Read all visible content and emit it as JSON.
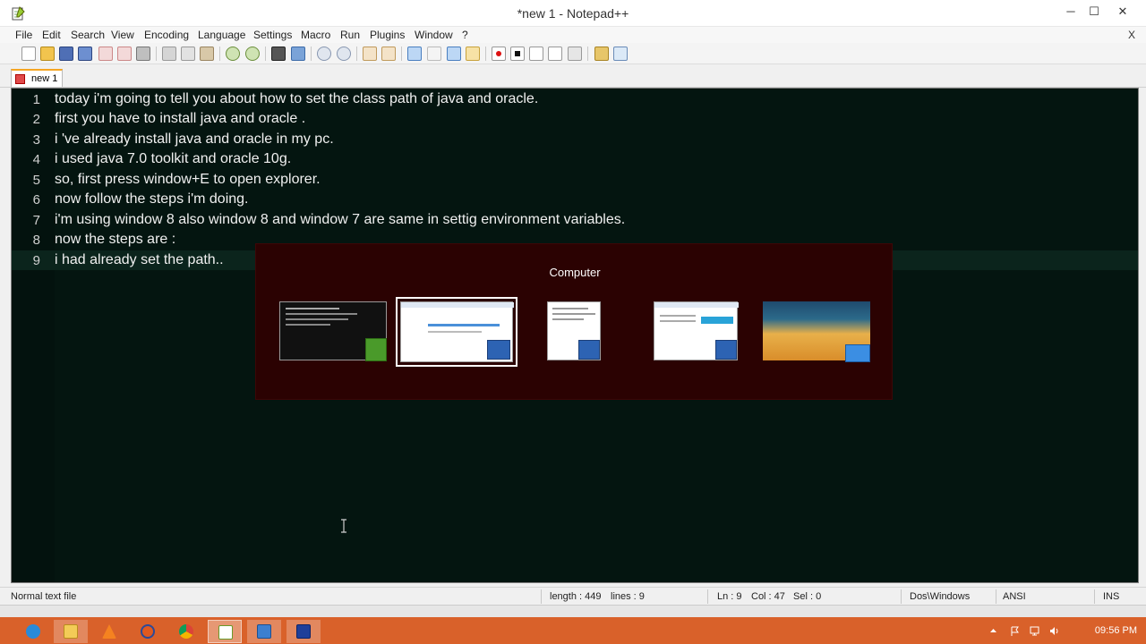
{
  "window": {
    "title": "*new  1 - Notepad++",
    "minimize_glyph": "─",
    "maximize_glyph": "☐",
    "close_glyph": "✕"
  },
  "menu": {
    "items": [
      "File",
      "Edit",
      "Search",
      "View",
      "Encoding",
      "Language",
      "Settings",
      "Macro",
      "Run",
      "Plugins",
      "Window",
      "?"
    ],
    "close_doc_glyph": "X"
  },
  "toolbar": {
    "icons": [
      "new-file-icon",
      "open-file-icon",
      "save-icon",
      "save-all-icon",
      "close-icon",
      "close-all-icon",
      "print-icon",
      "cut-icon",
      "copy-icon",
      "paste-icon",
      "undo-icon",
      "redo-icon",
      "find-icon",
      "replace-icon",
      "zoom-in-icon",
      "zoom-out-icon",
      "sync-vertical-icon",
      "sync-horizontal-icon",
      "word-wrap-icon",
      "show-all-chars-icon",
      "indent-guide-icon",
      "fold-icon",
      "record-macro-icon",
      "stop-macro-icon",
      "play-macro-icon",
      "run-macro-multiple-icon",
      "save-macro-icon",
      "open-folder-icon",
      "spell-check-icon"
    ]
  },
  "tabs": [
    {
      "label": "new  1",
      "modified": true
    }
  ],
  "editor": {
    "current_line": 9,
    "background": "#041510",
    "lines": [
      {
        "num": "1",
        "text": "today i'm going to tell you about how to set the class path of java and oracle."
      },
      {
        "num": "2",
        "text": "first you have to install java and oracle ."
      },
      {
        "num": "3",
        "text": "i 've already install java and oracle in my pc."
      },
      {
        "num": "4",
        "text": "i used java 7.0 toolkit and oracle 10g."
      },
      {
        "num": "5",
        "text": "so, first press window+E to open explorer."
      },
      {
        "num": "6",
        "text": "now follow the steps i'm doing."
      },
      {
        "num": "7",
        "text": "i'm using window 8 also window 8 and window 7 are same in settig environment variables."
      },
      {
        "num": "8",
        "text": "now the steps are :"
      },
      {
        "num": "9",
        "text": "i had already set the path.."
      }
    ]
  },
  "switcher": {
    "title": "Computer",
    "background": "#2b0202",
    "items": [
      {
        "name": "command-prompt-window",
        "selected": false,
        "badge": "cmd-icon"
      },
      {
        "name": "explorer-window",
        "selected": true,
        "badge": "computer-icon"
      },
      {
        "name": "notepad-document-window",
        "selected": false,
        "badge": "computer-icon"
      },
      {
        "name": "windows8-explorer-window",
        "selected": false,
        "badge": "computer-icon"
      },
      {
        "name": "desktop",
        "selected": false,
        "badge": "desktop-icon"
      }
    ]
  },
  "status": {
    "file_type": "Normal text file",
    "length": "length : 449",
    "lines": "lines : 9",
    "ln": "Ln : 9",
    "col": "Col : 47",
    "sel": "Sel : 0",
    "eol": "Dos\\Windows",
    "encoding": "ANSI",
    "mode": "INS"
  },
  "taskbar": {
    "color": "#d9612a",
    "apps": [
      "internet-explorer-icon",
      "file-explorer-icon",
      "vlc-icon",
      "firefox-icon",
      "chrome-icon",
      "notepad-plus-plus-icon",
      "remote-desktop-icon",
      "sql-plus-icon"
    ],
    "active_app": "notepad-plus-plus-icon",
    "clock": "09:56 PM"
  }
}
